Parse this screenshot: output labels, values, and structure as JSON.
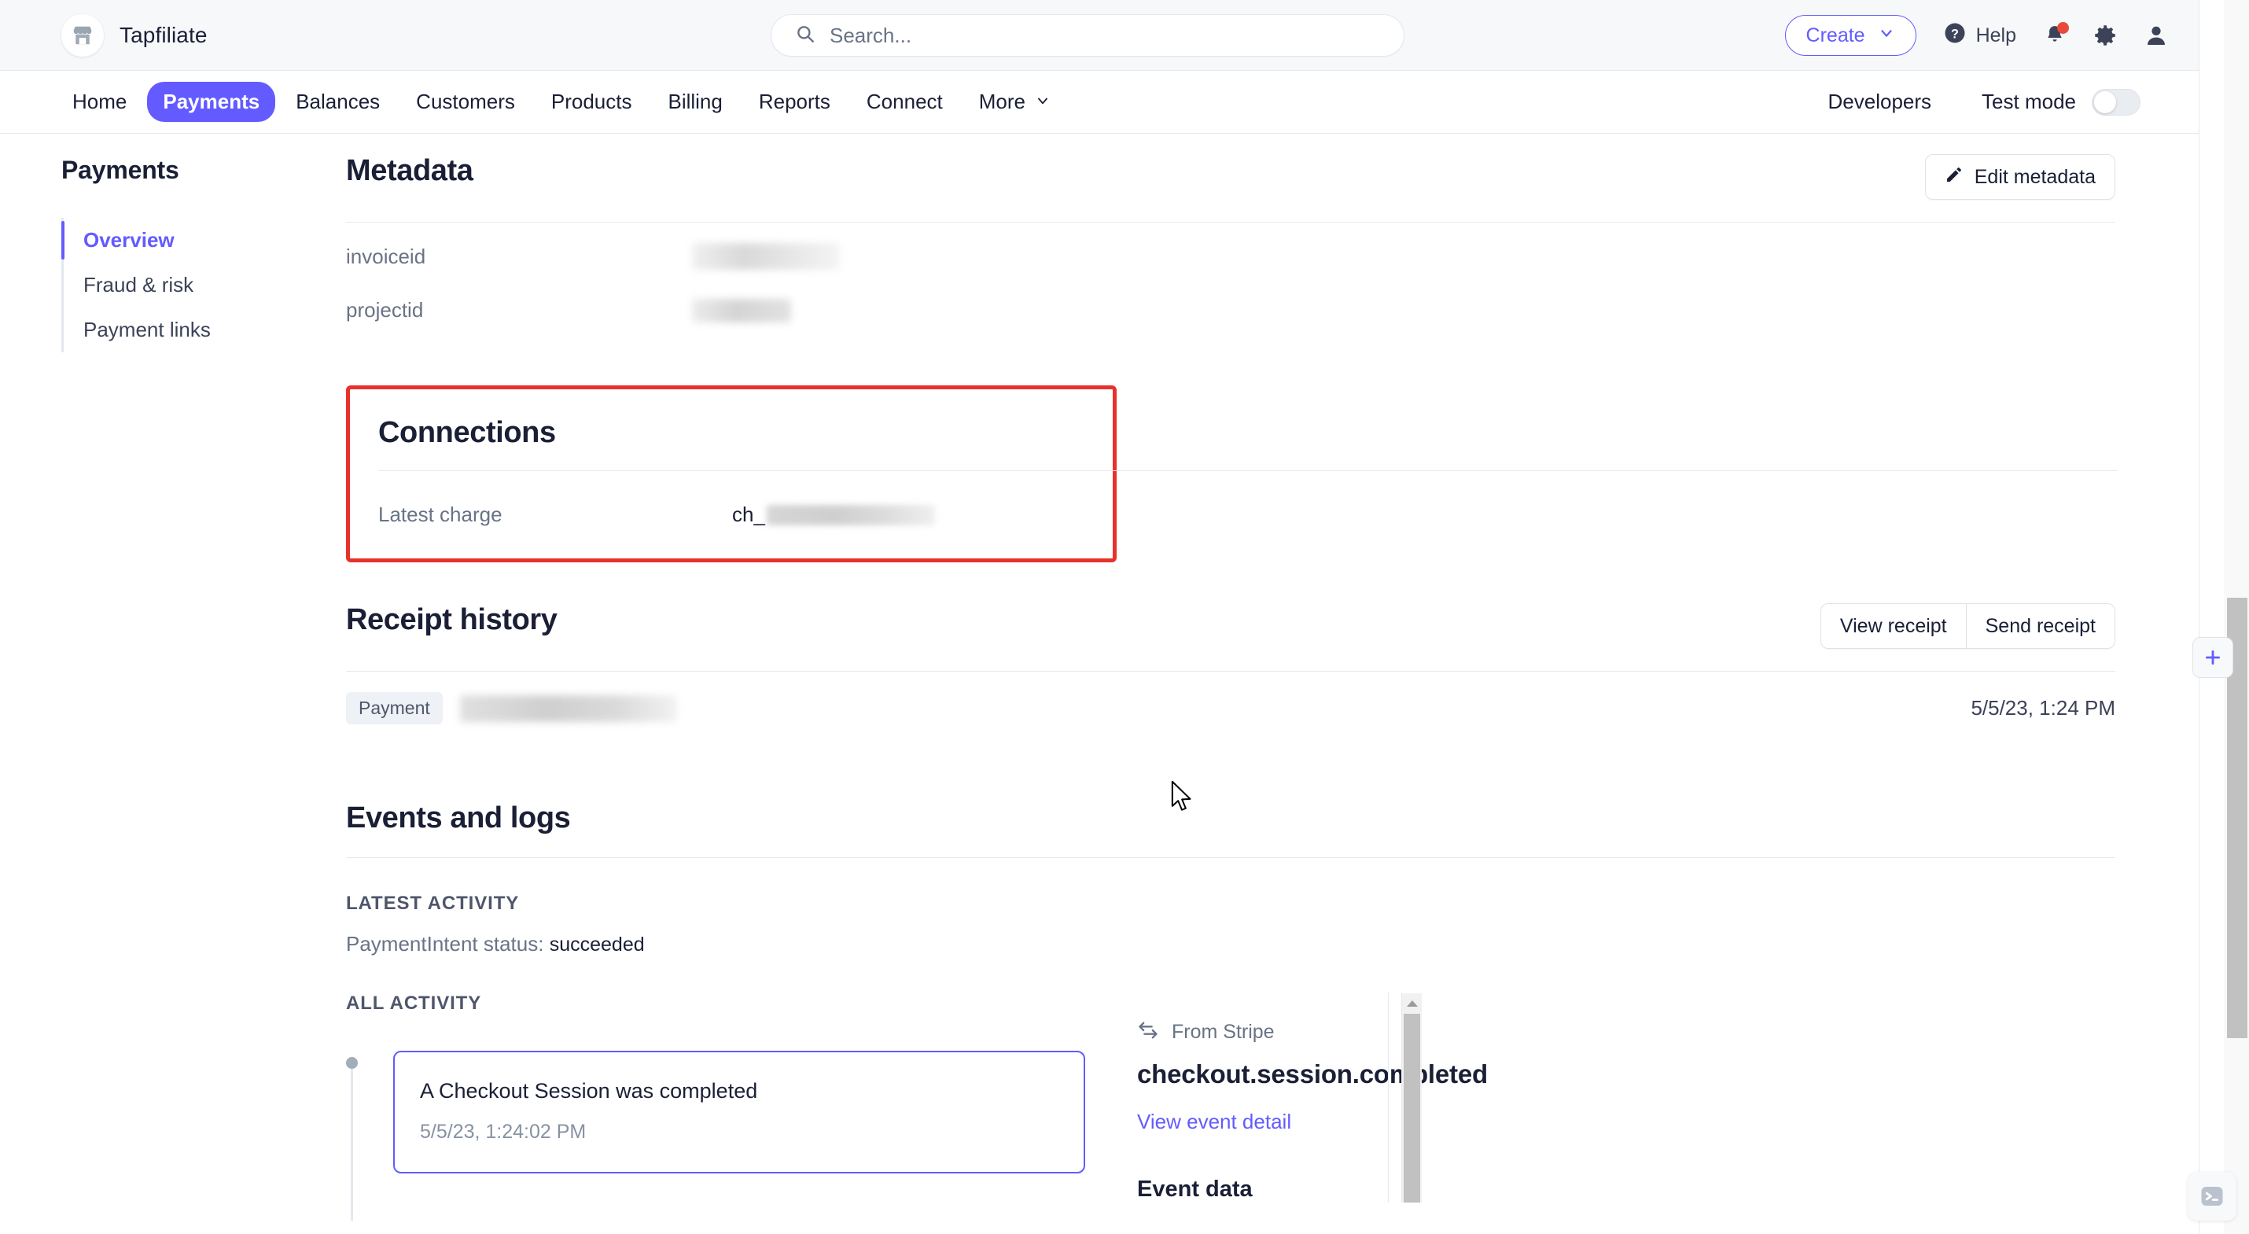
{
  "topbar": {
    "brand_name": "Tapfiliate",
    "brand_icon": "store-icon",
    "search_placeholder": "Search...",
    "search_value": "",
    "search_icon": "search-icon",
    "create_label": "Create",
    "create_chevron": "chevron-down-icon",
    "help_label": "Help",
    "help_icon": "question-circle-icon",
    "notifications_icon": "bell-icon",
    "notifications_badge": true,
    "settings_icon": "gear-icon",
    "account_icon": "user-avatar-icon"
  },
  "nav": {
    "items": [
      {
        "label": "Home",
        "active": false
      },
      {
        "label": "Payments",
        "active": true
      },
      {
        "label": "Balances",
        "active": false
      },
      {
        "label": "Customers",
        "active": false
      },
      {
        "label": "Products",
        "active": false
      },
      {
        "label": "Billing",
        "active": false
      },
      {
        "label": "Reports",
        "active": false
      },
      {
        "label": "Connect",
        "active": false
      },
      {
        "label": "More",
        "active": false
      }
    ],
    "more_chevron": "chevron-down-icon",
    "developers_label": "Developers",
    "test_mode_label": "Test mode",
    "test_mode_on": false
  },
  "sidebar": {
    "title": "Payments",
    "items": [
      {
        "label": "Overview",
        "active": true
      },
      {
        "label": "Fraud & risk",
        "active": false
      },
      {
        "label": "Payment links",
        "active": false
      }
    ]
  },
  "metadata": {
    "title": "Metadata",
    "edit_button_label": "Edit metadata",
    "edit_button_icon": "pencil-icon",
    "rows": [
      {
        "key": "invoiceid",
        "value": "",
        "redacted": true
      },
      {
        "key": "projectid",
        "value": "",
        "redacted": true
      }
    ]
  },
  "connections": {
    "title": "Connections",
    "highlighted": true,
    "highlight_color": "#e8312c",
    "rows": [
      {
        "key": "Latest charge",
        "value_prefix": "ch_",
        "value": "",
        "redacted": true
      }
    ]
  },
  "receipt_history": {
    "title": "Receipt history",
    "view_button_label": "View receipt",
    "send_button_label": "Send receipt",
    "rows": [
      {
        "badge": "Payment",
        "email": "",
        "redacted": true,
        "timestamp": "5/5/23, 1:24 PM"
      }
    ]
  },
  "events_and_logs": {
    "title": "Events and logs",
    "latest_activity_label": "LATEST ACTIVITY",
    "status_prefix": "PaymentIntent status:",
    "status_value": "succeeded",
    "all_activity_label": "ALL ACTIVITY",
    "activity_items": [
      {
        "title": "A Checkout Session was completed",
        "timestamp": "5/5/23, 1:24:02 PM",
        "selected": true
      }
    ],
    "detail": {
      "source_icon": "arrows-exchange-icon",
      "source_label": "From Stripe",
      "event_name": "checkout.session.completed",
      "view_link_label": "View event detail",
      "event_data_label": "Event data"
    }
  },
  "rail": {
    "add_icon": "plus-icon",
    "terminal_icon": "terminal-icon",
    "scroll_up_icon": "chevron-up-icon"
  },
  "colors": {
    "accent": "#635bff",
    "highlight": "#e8312c",
    "text": "#1a1f36",
    "muted": "#697386"
  }
}
